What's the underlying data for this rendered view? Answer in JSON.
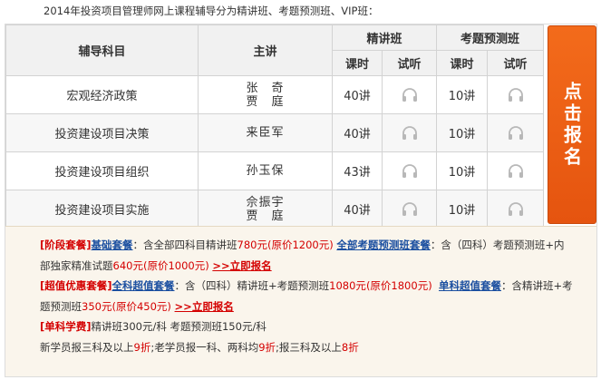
{
  "heading": "2014年投资项目管理师网上课程辅导分为精讲班、考题预测班、VIP班：",
  "table": {
    "headers": {
      "subject": "辅导科目",
      "lecturer": "主讲",
      "class1": "精讲班",
      "class2": "考题预测班",
      "hours": "课时",
      "listen": "试听"
    },
    "rows": [
      {
        "subject": "宏观经济政策",
        "lecturers": [
          "张　奇",
          "贾　庭"
        ],
        "hours1": "40讲",
        "hours2": "10讲"
      },
      {
        "subject": "投资建设项目决策",
        "lecturers": [
          "来臣军"
        ],
        "hours1": "40讲",
        "hours2": "10讲"
      },
      {
        "subject": "投资建设项目组织",
        "lecturers": [
          "孙玉保"
        ],
        "hours1": "43讲",
        "hours2": "10讲"
      },
      {
        "subject": "投资建设项目实施",
        "lecturers": [
          "佘振宇",
          "贾　庭"
        ],
        "hours1": "40讲",
        "hours2": "10讲"
      }
    ]
  },
  "signup_button": "点击报名",
  "promo": {
    "stage_tag": "[阶段套餐]",
    "basic_name": "基础套餐",
    "basic_text": "：含全部四科目精讲班",
    "basic_price": "780元",
    "basic_orig": "(原价1200元)",
    "all_pred_name": "全部考题预测班套餐",
    "all_pred_text_a": "：含（四科）考题预测班+内",
    "all_pred_text_b": "部独家精准试题",
    "all_pred_price": "640元",
    "all_pred_orig": "(原价1000元)",
    "signup_link": ">>立即报名",
    "super_tag": "[超值优惠套餐]",
    "full_name": "全科超值套餐",
    "full_text": "：含（四科）精讲班+考题预测班",
    "full_price": "1080元",
    "full_orig": "(原价1800元)",
    "single_name": "单科超值套餐",
    "single_text_a": "：含精讲班+考",
    "single_text_b": "题预测班",
    "single_price": "350元",
    "single_orig": "(原价450元)",
    "single_tag": "[单科学费]",
    "single_fee": "精讲班300元/科  考题预测班150元/科",
    "disc_a": "新学员报三科及以上",
    "disc_a_val": "9折",
    "disc_b": ";老学员报一科、两科均",
    "disc_b_val": "9折",
    "disc_c": ";报三科及以上",
    "disc_c_val": "8折"
  },
  "colors": {
    "accent": "#e5540f",
    "red": "#d40000",
    "blue": "#1b4fa0"
  },
  "icons": {
    "listen": "headphones-icon"
  }
}
